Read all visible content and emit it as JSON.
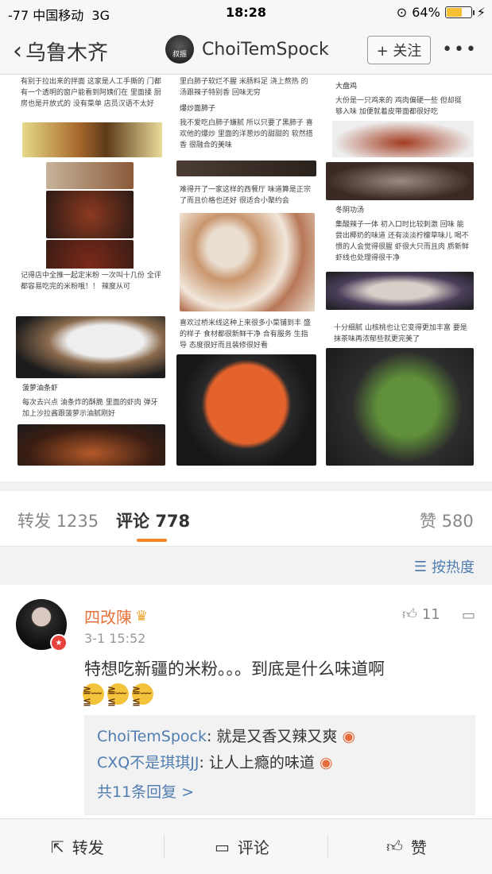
{
  "status_bar": {
    "carrier": "-77 中国移动",
    "network": "3G",
    "time": "18:28",
    "battery": "64%",
    "battery_level": 0.64
  },
  "nav": {
    "back_label": "乌鲁木齐",
    "username": "ChoiTemSpock",
    "avatar_text": "叔振",
    "follow_label": "+ 关注",
    "more_label": "•••"
  },
  "collage": {
    "col1": {
      "t1": "有别于拉出来的拌面 这家是人工手撕的 门都有一个透明的窗户能看到阿姨们在 里面揉 厨房也是开放式的 没有菜单 店员汉语不太好",
      "t2": "记得店中全推一起定米粉 一次叫十几份 全评都容易吃完的米粉哦！！ 辣度从可",
      "t3": "菠萝油条虾",
      "t4": "每次去兴点 油条炸的酥脆 里面的虾肉 弹牙 加上沙拉酱跟菠萝示油腻刚好"
    },
    "col2": {
      "t1": "里白肺子软烂不腥 米肠料足 浇上熬热 的汤跟辣子特别香 回味无穷",
      "t2": "爆炒面肺子",
      "t3": "我不爱吃白肺子嫌腻 所以只要了黑肺子 喜欢他的爆炒 里面的洋葱炒的甜甜的 软然搭香 很融合的美味",
      "t4": "难得开了一家这样的西餐厅 味道算是正宗了而且价格也还好 很适合小聚约会",
      "t5": "喜欢过桥米线这种上来很多小菜铺到丰 盛的样子 食材都很新鲜干净 合有服务 生指导 态度很好而且装修很好看"
    },
    "col3": {
      "t1": "大盘鸡",
      "t2": "大份是一只鸡来的 鸡肉偏硬一些 但却挺 够入味 加便就着皮带面都很好吃",
      "t3": "冬阴功汤",
      "t4": "集酸辣子一体 初入口时比较刺激 回味 能尝出椰奶的味道 还有淡淡柠檬草味儿 喝不惯的人会觉得很腥 虾很大只而且肉 质新鲜 虾线也处理得很干净",
      "t5": "十分细腻 山核桃也让它变得更加丰富 要是抹茶味再浓郁些就更完美了"
    }
  },
  "tabs": {
    "repost_label": "转发",
    "repost_count": "1235",
    "comment_label": "评论",
    "comment_count": "778",
    "like_label": "赞",
    "like_count": "580"
  },
  "sort": {
    "label": "按热度"
  },
  "comment": {
    "name": "四改陳",
    "time": "3-1 15:52",
    "likes": "11",
    "text": "特想吃新疆的米粉。。。到底是什么味道啊",
    "emoji": "≧﹏≦",
    "replies": [
      {
        "name": "ChoiTemSpock",
        "text": ": 就是又香又辣又爽"
      },
      {
        "name": "CXQ不是琪琪JJ",
        "text": ": 让人上瘾的味道"
      }
    ],
    "all_replies": "共11条回复 >"
  },
  "bottom_bar": {
    "repost": "转发",
    "comment": "评论",
    "like": "赞"
  },
  "colors": {
    "accent": "#f48523",
    "link": "#507daf",
    "username": "#e8733a"
  }
}
